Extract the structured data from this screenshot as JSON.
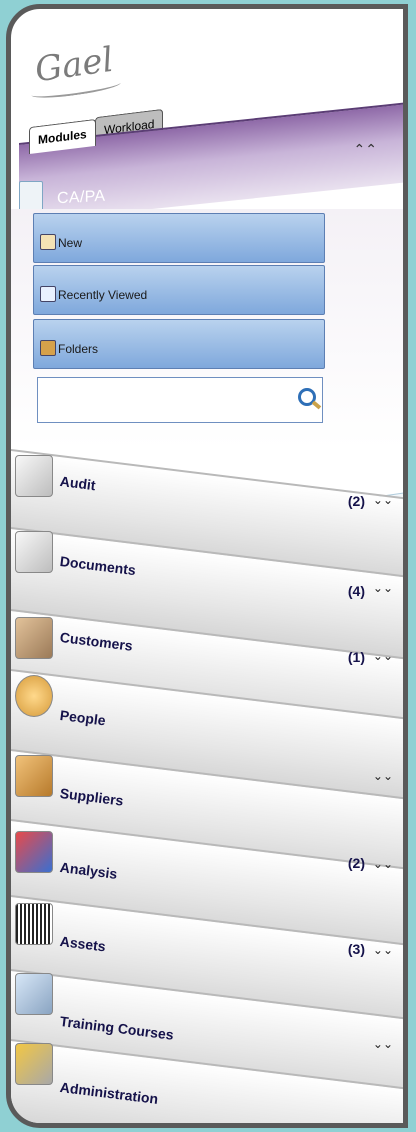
{
  "logo": "Gael",
  "tabs": [
    {
      "label": "Modules",
      "active": true
    },
    {
      "label": "Workload",
      "active": false
    }
  ],
  "header": {
    "title": "CA/PA",
    "collapse_icon": "double-chevron-up-icon",
    "accent_color": "#8f6aa8"
  },
  "actions": [
    {
      "label": "New",
      "icon": "new-document-icon"
    },
    {
      "label": "Recently Viewed",
      "icon": "recent-windows-icon"
    },
    {
      "label": "Folders",
      "icon": "folder-icon"
    }
  ],
  "search": {
    "value": "",
    "placeholder": "",
    "icon": "search-icon"
  },
  "modules": [
    {
      "name": "Audit",
      "count": "(2)",
      "icon": "audit-form-icon",
      "expand_icon": "double-chevron-down-icon"
    },
    {
      "name": "Documents",
      "count": "(4)",
      "icon": "documents-icon",
      "expand_icon": "double-chevron-down-icon"
    },
    {
      "name": "Customers",
      "count": "(1)",
      "icon": "handshake-icon",
      "expand_icon": "double-chevron-down-icon"
    },
    {
      "name": "People",
      "count": "",
      "icon": "person-icon",
      "expand_icon": ""
    },
    {
      "name": "Suppliers",
      "count": "",
      "icon": "boxes-icon",
      "expand_icon": "double-chevron-down-icon"
    },
    {
      "name": "Analysis",
      "count": "(2)",
      "icon": "chart-icon",
      "expand_icon": "double-chevron-down-icon"
    },
    {
      "name": "Assets",
      "count": "(3)",
      "icon": "asset-barcode-icon",
      "expand_icon": "double-chevron-down-icon"
    },
    {
      "name": "Training Courses",
      "count": "",
      "icon": "training-icon",
      "expand_icon": "double-chevron-down-icon"
    },
    {
      "name": "Administration",
      "count": "",
      "icon": "gear-admin-icon",
      "expand_icon": ""
    }
  ]
}
